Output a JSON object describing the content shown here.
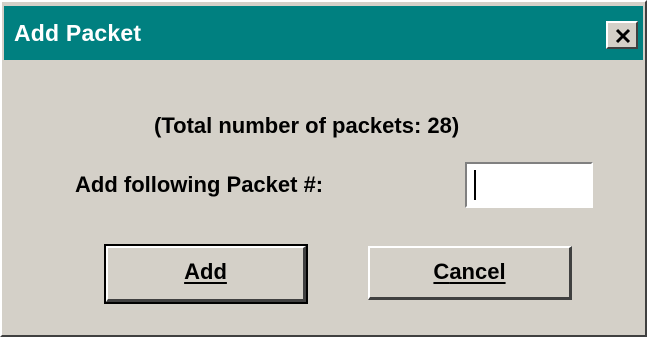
{
  "window": {
    "title": "Add Packet",
    "close_icon": "close-icon"
  },
  "dialog": {
    "total_text": "(Total number of packets: 28)",
    "field_label": "Add following Packet #:",
    "packet_input": {
      "value": "",
      "placeholder": ""
    },
    "buttons": {
      "add": {
        "mnemonic": "A",
        "rest": "dd"
      },
      "cancel": {
        "mnemonic": "C",
        "rest": "ancel"
      }
    }
  },
  "colors": {
    "titlebar": "#008080",
    "face": "#d4d0c8",
    "title_text": "#ffffff"
  }
}
